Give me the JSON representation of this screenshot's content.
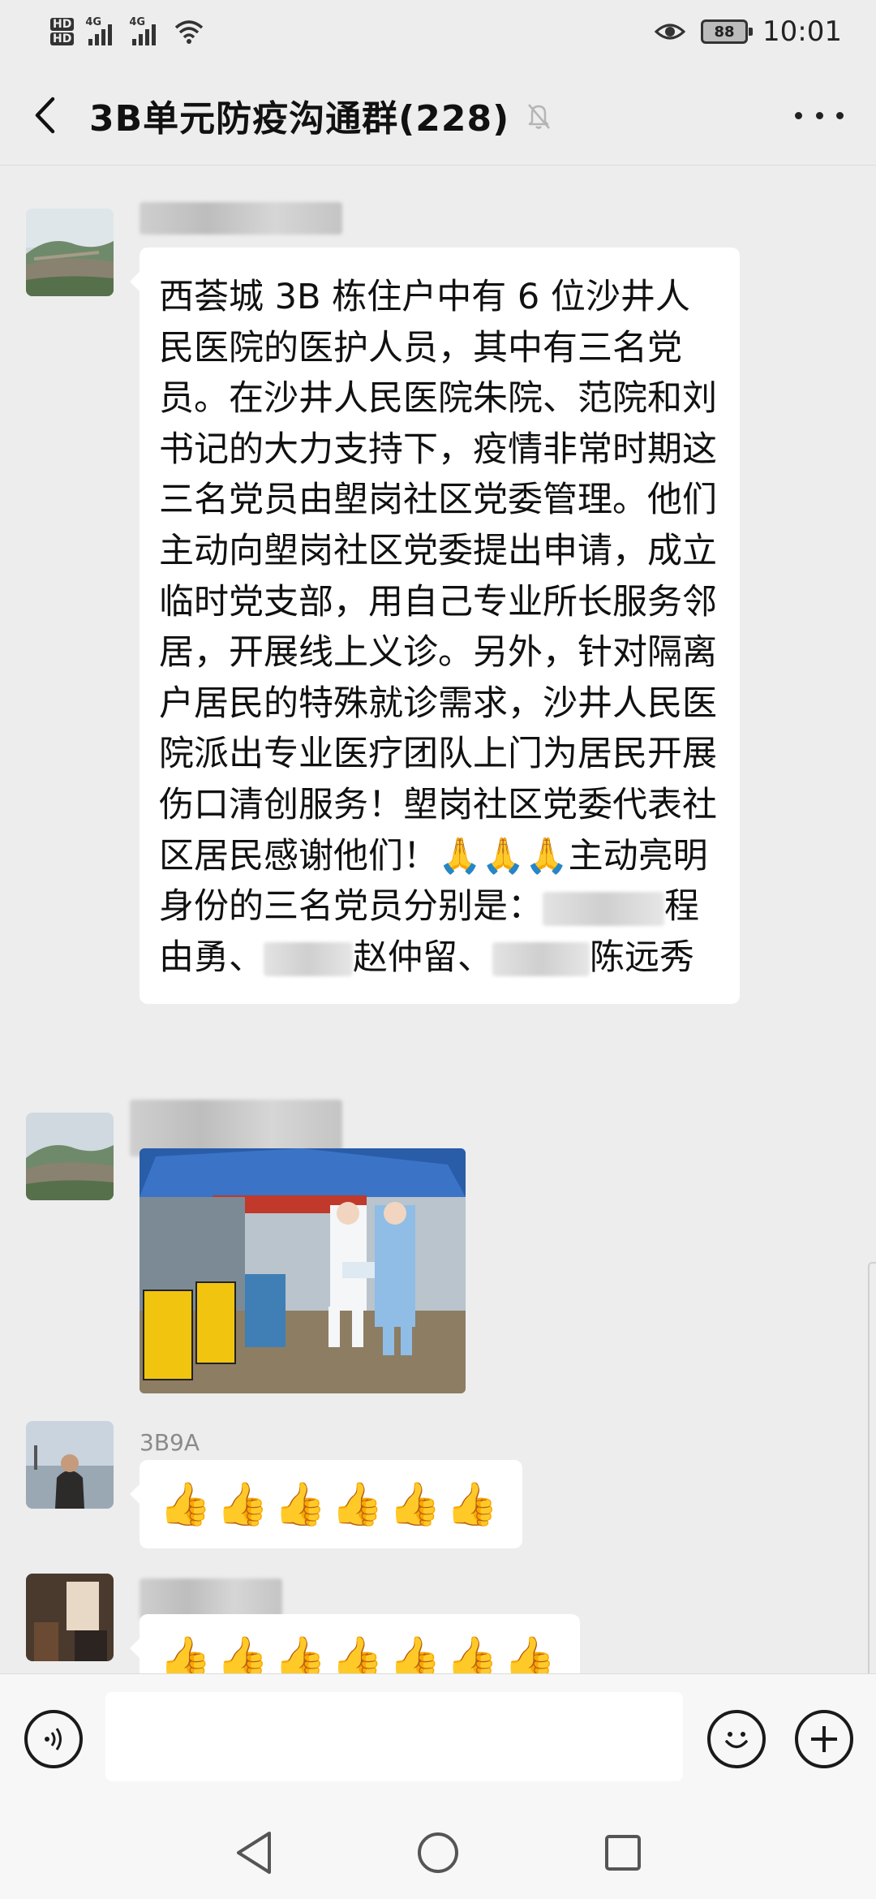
{
  "status_bar": {
    "hd_top": "HD",
    "hd_bottom": "HD",
    "net1": "4G",
    "net2": "4G",
    "battery": "88",
    "time": "10:01"
  },
  "header": {
    "title": "3B单元防疫沟通群(228)",
    "back_icon": "chevron-left-icon",
    "mute_icon": "bell-off-icon",
    "more_icon": "more-dots-icon"
  },
  "messages": [
    {
      "sender": "",
      "text_part1": "西荟城 3B 栋住户中有 6 位沙井人民医院的医护人员，其中有三名党员。在沙井人民医院朱院、范院和刘书记的大力支持下，疫情非常时期这三名党员由塱岗社区党委管理。他们主动向塱岗社区党委提出申请，成立临时党支部，用自己专业所长服务邻居，开展线上义诊。另外，针对隔离户居民的特殊就诊需求，沙井人民医院派出专业医疗团队上门为居民开展伤口清创服务！塱岗社区党委代表社区居民感谢他们！",
      "emoji_prefix": "🙏🙏🙏",
      "text_part2": "主动亮明身份的三名党员分别是：",
      "member1": "程由勇、",
      "member2": "赵仲留、",
      "member3": "陈远秀"
    },
    {
      "sender": "",
      "type": "image",
      "image_desc": "photo"
    },
    {
      "sender": "3B9A",
      "emoji": "👍👍👍👍👍👍"
    },
    {
      "sender": "",
      "emoji": "👍👍👍👍👍👍👍"
    }
  ],
  "input": {
    "placeholder": ""
  },
  "colors": {
    "background": "#ededed",
    "bubble": "#ffffff",
    "text": "#111111"
  }
}
